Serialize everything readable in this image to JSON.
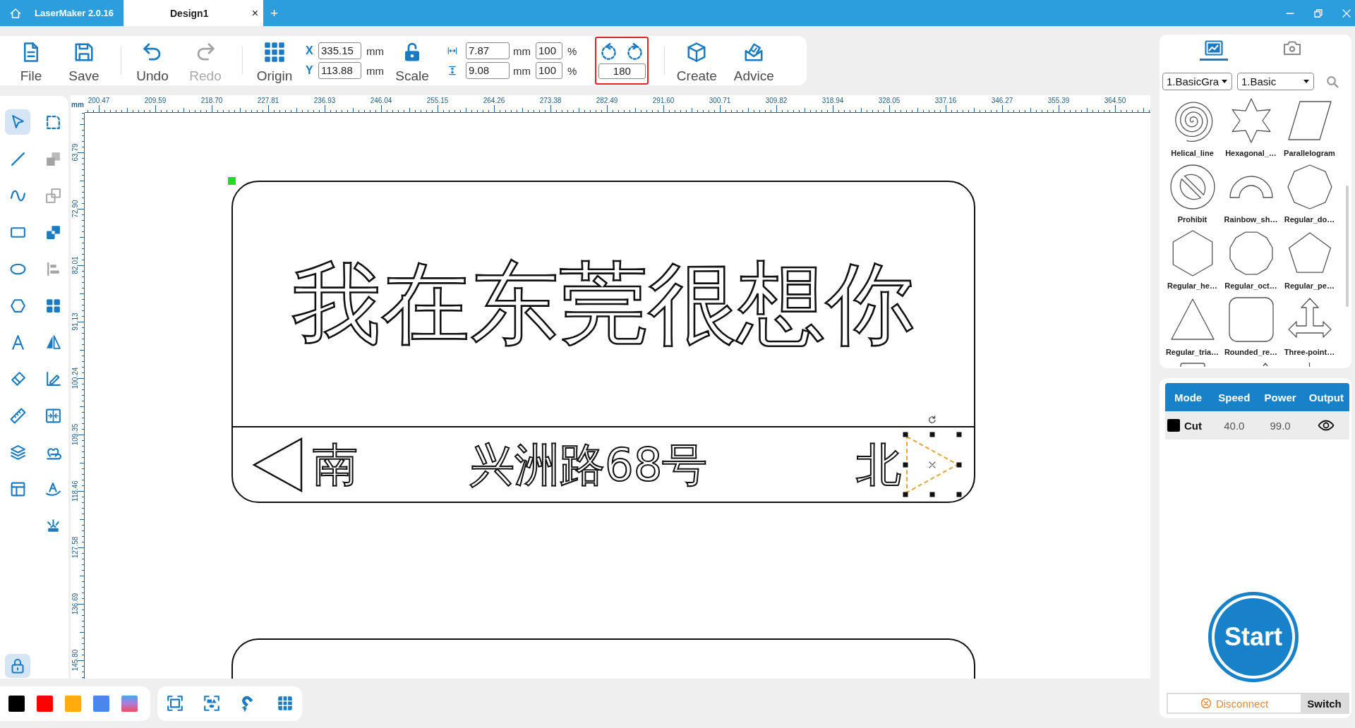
{
  "titlebar": {
    "app_name": "LaserMaker 2.0.16",
    "tabs": [
      {
        "label": "Design1",
        "selected": true,
        "close": "×"
      }
    ],
    "new_tab": "+"
  },
  "toolbar": {
    "items": [
      {
        "kind": "file",
        "label": "File",
        "disabled": false
      },
      {
        "kind": "save",
        "label": "Save",
        "disabled": false
      },
      {
        "kind": "separator"
      },
      {
        "kind": "undo",
        "label": "Undo",
        "disabled": false
      },
      {
        "kind": "redo",
        "label": "Redo",
        "disabled": true
      },
      {
        "kind": "separator"
      },
      {
        "kind": "origin",
        "label": "Origin",
        "disabled": false
      },
      {
        "kind": "position",
        "rows": [
          {
            "axis": "X",
            "value": "335.15",
            "unit": "mm"
          },
          {
            "axis": "Y",
            "value": "113.88",
            "unit": "mm"
          }
        ]
      },
      {
        "kind": "scale",
        "label": "Scale",
        "locked": false
      },
      {
        "kind": "size",
        "rows": [
          {
            "kind": "width",
            "value": "7.87",
            "unit": "mm",
            "percent": "100",
            "percent_sign": "%"
          },
          {
            "kind": "height",
            "value": "9.08",
            "unit": "mm",
            "percent": "100",
            "percent_sign": "%"
          }
        ]
      },
      {
        "kind": "rotate",
        "angle": "180",
        "highlighted": true
      },
      {
        "kind": "separator"
      },
      {
        "kind": "create",
        "label": "Create",
        "disabled": false
      },
      {
        "kind": "advice",
        "label": "Advice",
        "disabled": false
      }
    ]
  },
  "rulers": {
    "unit": "mm",
    "top_labels": [
      "200.47",
      "209.59",
      "218.70",
      "227.81",
      "236.93",
      "246.04",
      "255.15",
      "264.26",
      "273.38",
      "282.49",
      "291.60",
      "300.71",
      "309.82",
      "318.94",
      "328.05",
      "337.16",
      "346.27",
      "355.39",
      "364.50"
    ],
    "left_labels": [
      "63.79",
      "72.90",
      "82.01",
      "91.13",
      "100.24",
      "109.35",
      "118.46",
      "127.58",
      "136.69",
      "145.80"
    ]
  },
  "left_toolbar": {
    "columns": [
      {
        "tools": [
          {
            "kind": "select",
            "selected": true,
            "disabled": false
          },
          {
            "kind": "line",
            "selected": false,
            "disabled": false
          },
          {
            "kind": "curve",
            "selected": false,
            "disabled": false
          },
          {
            "kind": "rectangle",
            "selected": false,
            "disabled": false
          },
          {
            "kind": "ellipse",
            "selected": false,
            "disabled": false
          },
          {
            "kind": "polygon",
            "selected": false,
            "disabled": false
          },
          {
            "kind": "text",
            "selected": false,
            "disabled": false
          },
          {
            "kind": "eraser",
            "selected": false,
            "disabled": false
          },
          {
            "kind": "measure",
            "selected": false,
            "disabled": false
          },
          {
            "kind": "layers",
            "selected": false,
            "disabled": false
          },
          {
            "kind": "layout",
            "selected": false,
            "disabled": false
          }
        ]
      },
      {
        "tools": [
          {
            "kind": "node",
            "selected": false,
            "disabled": false
          },
          {
            "kind": "combine",
            "selected": false,
            "disabled": true
          },
          {
            "kind": "duplicate",
            "selected": false,
            "disabled": true
          },
          {
            "kind": "boolean",
            "selected": false,
            "disabled": false
          },
          {
            "kind": "align",
            "selected": false,
            "disabled": true
          },
          {
            "kind": "array",
            "selected": false,
            "disabled": false
          },
          {
            "kind": "mirror",
            "selected": false,
            "disabled": false
          },
          {
            "kind": "offset",
            "selected": false,
            "disabled": false
          },
          {
            "kind": "split",
            "selected": false,
            "disabled": false
          },
          {
            "kind": "weld",
            "selected": false,
            "disabled": false
          },
          {
            "kind": "textpath",
            "selected": false,
            "disabled": false
          },
          {
            "kind": "laser",
            "selected": false,
            "disabled": false
          }
        ]
      }
    ],
    "lock": {
      "on": true
    }
  },
  "canvas": {
    "sign": {
      "headline": "我在东莞很想你",
      "left_arrow": {
        "selected": false
      },
      "left_direction": "南",
      "road": "兴洲路68号",
      "right_direction": "北",
      "right_arrow": {
        "selected": true
      }
    },
    "partial_sign_below": true
  },
  "color_palette": [
    {
      "kind": "solid",
      "color": "#000000"
    },
    {
      "kind": "solid",
      "color": "#ff0000"
    },
    {
      "kind": "solid",
      "color": "#ffac0c"
    },
    {
      "kind": "solid",
      "color": "#4a86ec"
    },
    {
      "kind": "gradient"
    }
  ],
  "right_panel": {
    "tabs": [
      {
        "kind": "shapes",
        "selected": true
      },
      {
        "kind": "camera",
        "selected": false
      }
    ],
    "dropdowns": [
      {
        "value": "1.BasicGra"
      },
      {
        "value": "1.Basic"
      }
    ],
    "shapes": [
      {
        "kind": "spiral",
        "label": "Helical_line"
      },
      {
        "kind": "star",
        "label": "Hexagonal_…"
      },
      {
        "kind": "parallelogram",
        "label": "Parallelogram"
      },
      {
        "kind": "prohibit",
        "label": "Prohibit"
      },
      {
        "kind": "arch",
        "label": "Rainbow_sh…"
      },
      {
        "kind": "octagon",
        "label": "Regular_do…"
      },
      {
        "kind": "hexagon",
        "label": "Regular_he…"
      },
      {
        "kind": "dodecagon",
        "label": "Regular_oct…"
      },
      {
        "kind": "pentagon",
        "label": "Regular_pe…"
      },
      {
        "kind": "triangle",
        "label": "Regular_tria…"
      },
      {
        "kind": "roundrect",
        "label": "Rounded_re…"
      },
      {
        "kind": "threearrow",
        "label": "Three-point…"
      }
    ],
    "partial_shapes": [
      {
        "kind": "squaretop"
      },
      {
        "kind": "peaktop"
      },
      {
        "kind": "stemtop"
      }
    ]
  },
  "layers": {
    "columns": [
      "Mode",
      "Speed",
      "Power",
      "Output"
    ],
    "rows": [
      {
        "color": "#000000",
        "mode": "Cut",
        "speed": "40.0",
        "power": "99.0",
        "visible": true
      }
    ]
  },
  "start_button": "Start",
  "connection": {
    "status": "Disconnect",
    "switch": "Switch"
  }
}
